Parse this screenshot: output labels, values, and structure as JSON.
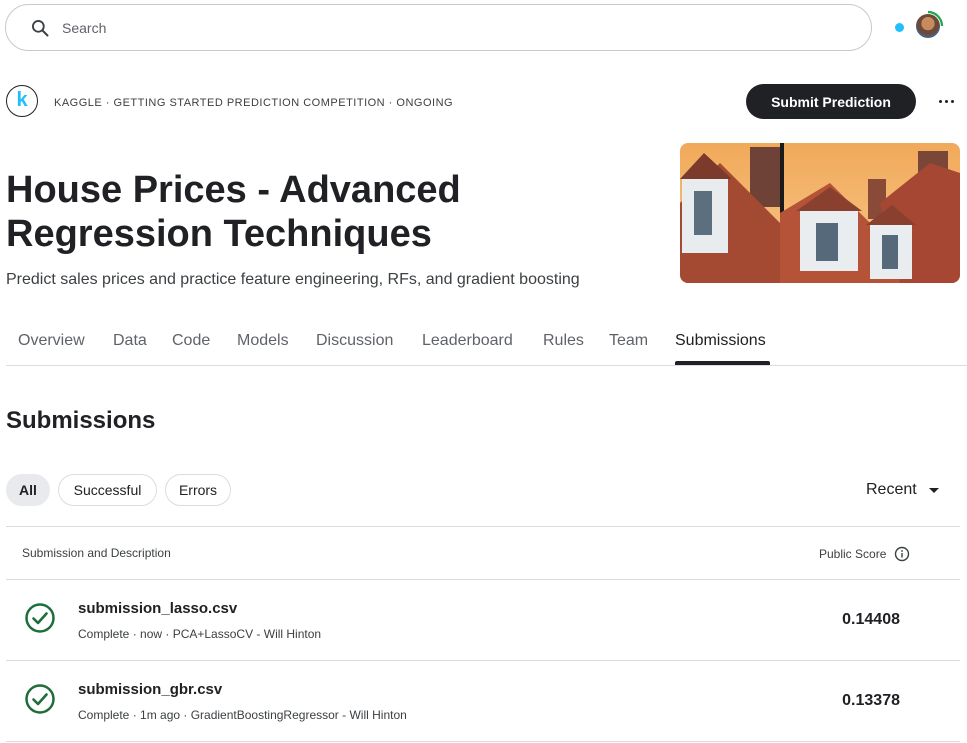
{
  "search": {
    "placeholder": "Search"
  },
  "competition": {
    "logo_letter": "k",
    "breadcrumb": "KAGGLE · GETTING STARTED PREDICTION COMPETITION · ONGOING",
    "submit_label": "Submit Prediction",
    "title": "House Prices - Advanced Regression Techniques",
    "subtitle": "Predict sales prices and practice feature engineering, RFs, and gradient boosting"
  },
  "tabs": [
    {
      "label": "Overview"
    },
    {
      "label": "Data"
    },
    {
      "label": "Code"
    },
    {
      "label": "Models"
    },
    {
      "label": "Discussion"
    },
    {
      "label": "Leaderboard"
    },
    {
      "label": "Rules"
    },
    {
      "label": "Team"
    },
    {
      "label": "Submissions",
      "active": true
    }
  ],
  "submissions": {
    "heading": "Submissions",
    "filters": [
      {
        "label": "All",
        "active": true
      },
      {
        "label": "Successful"
      },
      {
        "label": "Errors"
      }
    ],
    "sort_label": "Recent",
    "col_left": "Submission and Description",
    "col_right": "Public Score",
    "rows": [
      {
        "name": "submission_lasso.csv",
        "meta": "Complete · now · PCA+LassoCV - Will Hinton",
        "score": "0.14408"
      },
      {
        "name": "submission_gbr.csv",
        "meta": "Complete · 1m ago · GradientBoostingRegressor - Will Hinton",
        "score": "0.13378"
      }
    ]
  },
  "colors": {
    "accent": "#20beff",
    "success": "#1e6e3a",
    "button": "#202124"
  }
}
